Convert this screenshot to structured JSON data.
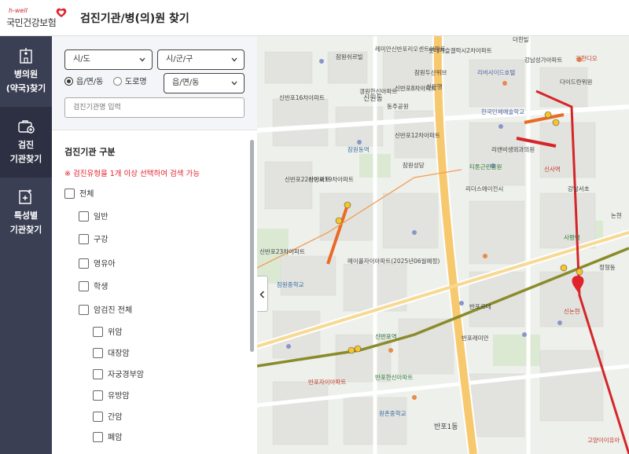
{
  "header": {
    "logo_sub": "h-well",
    "logo_main": "국민건강보험",
    "title": "검진기관/병(의)원 찾기"
  },
  "nav": {
    "items": [
      {
        "line1": "병의원",
        "line2": "(약국)찾기",
        "icon": "hospital-icon"
      },
      {
        "line1": "검진",
        "line2": "기관찾기",
        "icon": "checkup-bag-icon"
      },
      {
        "line1": "특성별",
        "line2": "기관찾기",
        "icon": "document-plus-icon"
      }
    ]
  },
  "filters": {
    "sido": "시/도",
    "sigungu": "시/군/구",
    "radio_1": "읍/면/동",
    "radio_2": "도로명",
    "dong": "읍/면/동",
    "search_placeholder": "검진기관명 입력"
  },
  "category": {
    "title": "검진기관 구분",
    "notice": "※ 검진유형을 1개 이상 선택하여 검색 가능",
    "all": "전체",
    "items": [
      "일반",
      "구강",
      "영유아",
      "학생",
      "암검진 전체"
    ],
    "cancer_items": [
      "위암",
      "대장암",
      "자궁경부암",
      "유방암",
      "간암",
      "폐암"
    ]
  },
  "map": {
    "labels": [
      "잠원쉬르빌",
      "레미안신반포리오센트아파트",
      "롯데캐슬갤럭시2차아파트",
      "더힌빌",
      "잠원두산위브",
      "강남성가아파트",
      "관한디오",
      "리버사이드호텔",
      "다이드란위원",
      "신반포16차아파트",
      "갱원한신아파트",
      "신원동",
      "신반포8차아파트",
      "신은행",
      "잠원동역",
      "동주공원",
      "신반포22차아파트",
      "신반포12차아파트",
      "신반포19차아파트",
      "신반포23차아파트",
      "논현",
      "신사역",
      "메이플자이아파트(2025년06월예정)",
      "반포한신아파트",
      "반포1동",
      "신반포역",
      "잠원중학교",
      "원촌중학교",
      "반포자이아파트",
      "반포래미안",
      "한국인체예술학교",
      "리앤비생외과의원",
      "티톤근린공원",
      "잠원성당",
      "리더스에이전시",
      "강남서초",
      "정형동",
      "반포르테",
      "신논현",
      "사평역",
      "고양이이유아"
    ]
  }
}
